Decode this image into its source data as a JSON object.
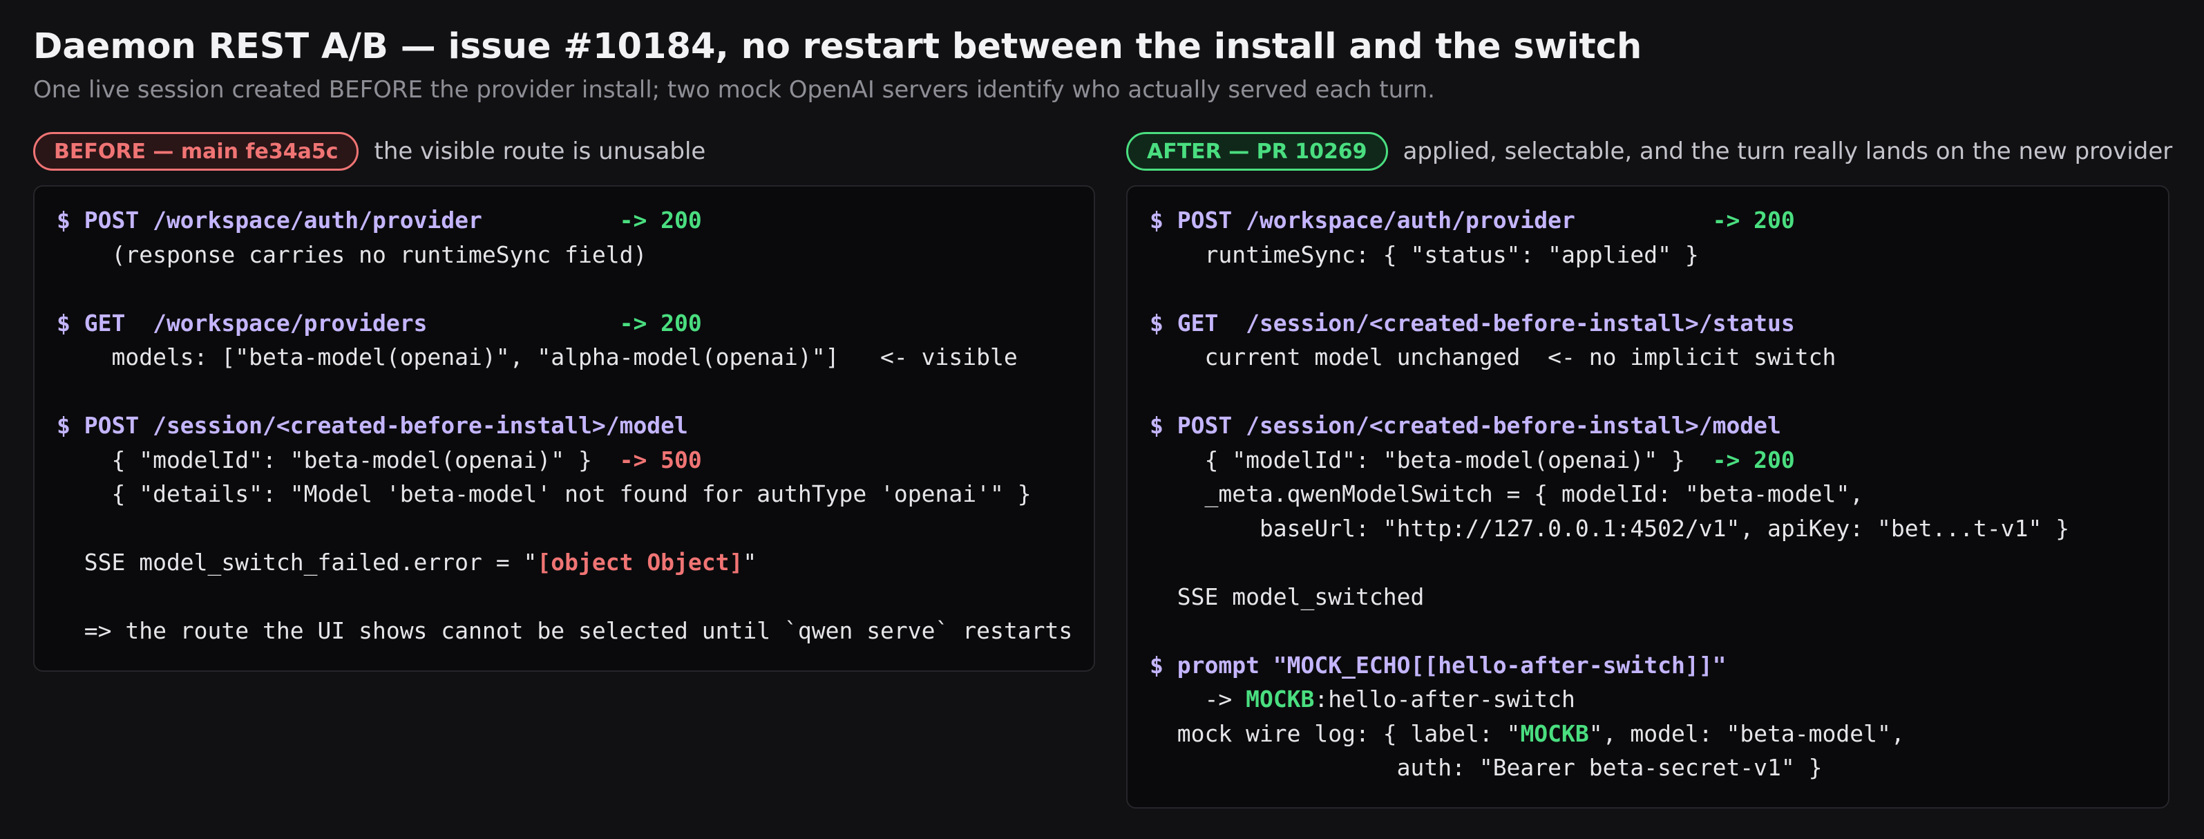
{
  "header": {
    "title": "Daemon REST A/B — issue #10184, no restart between the install and the switch",
    "subtitle": "One live session created BEFORE the provider install; two mock OpenAI servers identify who actually served each turn."
  },
  "before": {
    "badge": "BEFORE — main fe34a5c",
    "caption": "the visible route is unusable",
    "lines": [
      [
        {
          "t": "$ POST /workspace/auth/provider          ",
          "c": "cmd"
        },
        {
          "t": "-> 200",
          "c": "ok"
        }
      ],
      [
        {
          "t": "    (response carries no runtimeSync field)",
          "c": ""
        }
      ],
      [],
      [
        {
          "t": "$ GET  /workspace/providers              ",
          "c": "cmd"
        },
        {
          "t": "-> 200",
          "c": "ok"
        }
      ],
      [
        {
          "t": "    models: [\"beta-model(openai)\", \"alpha-model(openai)\"]   <- visible",
          "c": ""
        }
      ],
      [],
      [
        {
          "t": "$ POST /session/<created-before-install>/model",
          "c": "cmd"
        }
      ],
      [
        {
          "t": "    { \"modelId\": \"beta-model(openai)\" }  ",
          "c": ""
        },
        {
          "t": "-> 500",
          "c": "err"
        }
      ],
      [
        {
          "t": "    { \"details\": \"Model 'beta-model' not found for authType 'openai'\" }",
          "c": ""
        }
      ],
      [],
      [
        {
          "t": "  SSE model_switch_failed.error = \"",
          "c": ""
        },
        {
          "t": "[object Object]",
          "c": "err"
        },
        {
          "t": "\"",
          "c": ""
        }
      ],
      [],
      [
        {
          "t": "  => the route the UI shows cannot be selected until `qwen serve` restarts",
          "c": ""
        }
      ]
    ]
  },
  "after": {
    "badge": "AFTER — PR 10269",
    "caption": "applied, selectable, and the turn really lands on the new provider",
    "lines": [
      [
        {
          "t": "$ POST /workspace/auth/provider          ",
          "c": "cmd"
        },
        {
          "t": "-> 200",
          "c": "ok"
        }
      ],
      [
        {
          "t": "    runtimeSync: { \"status\": \"applied\" }",
          "c": ""
        }
      ],
      [],
      [
        {
          "t": "$ GET  /session/<created-before-install>/status",
          "c": "cmd"
        }
      ],
      [
        {
          "t": "    current model unchanged  <- no implicit switch",
          "c": ""
        }
      ],
      [],
      [
        {
          "t": "$ POST /session/<created-before-install>/model",
          "c": "cmd"
        }
      ],
      [
        {
          "t": "    { \"modelId\": \"beta-model(openai)\" }  ",
          "c": ""
        },
        {
          "t": "-> 200",
          "c": "ok"
        }
      ],
      [
        {
          "t": "    _meta.qwenModelSwitch = { modelId: \"beta-model\",",
          "c": ""
        }
      ],
      [
        {
          "t": "        baseUrl: \"http://127.0.0.1:4502/v1\", apiKey: \"bet...t-v1\" }",
          "c": ""
        }
      ],
      [],
      [
        {
          "t": "  SSE model_switched",
          "c": ""
        }
      ],
      [],
      [
        {
          "t": "$ prompt \"MOCK_ECHO[[hello-after-switch]]\"",
          "c": "cmd"
        }
      ],
      [
        {
          "t": "    -> ",
          "c": ""
        },
        {
          "t": "MOCKB",
          "c": "ok"
        },
        {
          "t": ":hello-after-switch",
          "c": ""
        }
      ],
      [
        {
          "t": "  mock wire log: { label: \"",
          "c": ""
        },
        {
          "t": "MOCKB",
          "c": "ok"
        },
        {
          "t": "\", model: \"beta-model\",",
          "c": ""
        }
      ],
      [
        {
          "t": "                  auth: \"Bearer beta-secret-v1\" }",
          "c": ""
        }
      ]
    ]
  }
}
